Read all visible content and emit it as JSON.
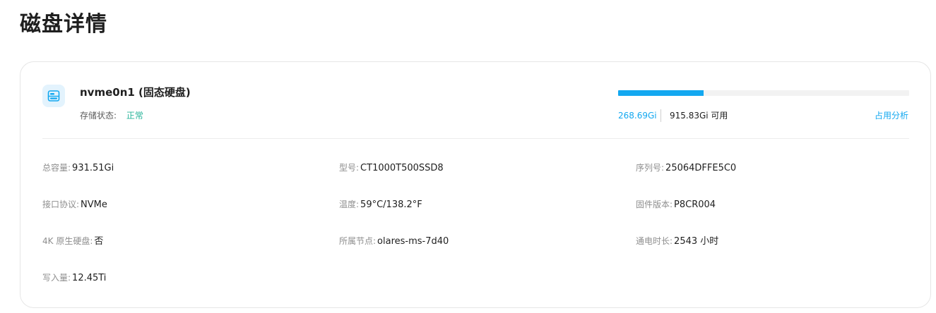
{
  "page": {
    "title": "磁盘详情"
  },
  "disk": {
    "icon": "disk-icon",
    "name": "nvme0n1 (固态硬盘)",
    "status_label": "存储状态:",
    "status_value": "正常",
    "status_color": "#29b49a"
  },
  "usage": {
    "used": "268.69Gi",
    "free": "915.83Gi 可用",
    "used_fraction": 0.2934,
    "accent_color": "#13a8f0",
    "analysis_link": "占用分析"
  },
  "details": [
    {
      "label": "总容量:",
      "value": "931.51Gi"
    },
    {
      "label": "型号:",
      "value": "CT1000T500SSD8"
    },
    {
      "label": "序列号:",
      "value": "25064DFFE5C0"
    },
    {
      "label": "接口协议:",
      "value": "NVMe"
    },
    {
      "label": "温度:",
      "value": "59°C/138.2°F"
    },
    {
      "label": "固件版本:",
      "value": "P8CR004"
    },
    {
      "label": "4K 原生硬盘:",
      "value": "否"
    },
    {
      "label": "所属节点:",
      "value": "olares-ms-7d40"
    },
    {
      "label": "通电时长:",
      "value": "2543 小时"
    },
    {
      "label": "写入量:",
      "value": "12.45Ti"
    }
  ]
}
